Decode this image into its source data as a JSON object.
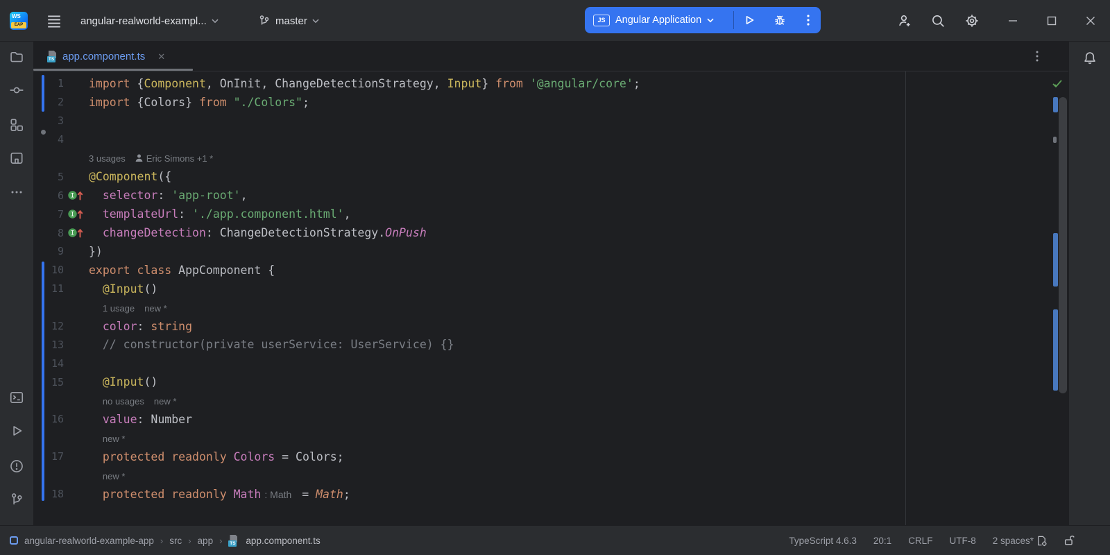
{
  "colors": {
    "accent_blue": "#3574F0",
    "panel_bg": "#2B2D30",
    "editor_bg": "#1E1F22",
    "keyword_orange": "#CF8E6D",
    "string_green": "#6AAB73",
    "decorator_yellow": "#C9B55C",
    "property_purple": "#C77DBB",
    "comment_gray": "#7A7E85",
    "modified_file_blue": "#6C9CF0",
    "logo_badge_yellow": "#F5C943",
    "gutter_change_blue": "#3574F0",
    "check_green": "#5C9F57"
  },
  "title_bar": {
    "app_badge": "WS",
    "app_badge_sub": "EAP",
    "project": "angular-realworld-exampl...",
    "branch": "master",
    "run_config": {
      "badge": "JS",
      "label": "Angular Application"
    }
  },
  "tab_bar": {
    "tabs": [
      {
        "label": "app.component.ts",
        "active": true
      }
    ]
  },
  "editor": {
    "change_bars": [
      {
        "from": 0,
        "to": 1
      },
      {
        "from": 10,
        "to": 22
      }
    ],
    "lines": [
      {
        "n": "1",
        "seg": [
          [
            "kw",
            "import "
          ],
          [
            "def",
            "{"
          ],
          [
            "deco",
            "Component"
          ],
          [
            "def",
            ", OnInit, ChangeDetectionStrategy, "
          ],
          [
            "deco",
            "Input"
          ],
          [
            "def",
            "} "
          ],
          [
            "kw",
            "from "
          ],
          [
            "str",
            "'@angular/core'"
          ],
          [
            "def",
            ";"
          ]
        ]
      },
      {
        "n": "2",
        "seg": [
          [
            "kw",
            "import "
          ],
          [
            "def",
            "{Colors} "
          ],
          [
            "kw",
            "from "
          ],
          [
            "str",
            "\"./Colors\""
          ],
          [
            "def",
            ";"
          ]
        ]
      },
      {
        "n": "3",
        "seg": []
      },
      {
        "n": "4",
        "seg": []
      },
      {
        "inlay": true,
        "seg": [
          [
            "usages",
            "3 usages"
          ],
          [
            "gap",
            ""
          ],
          [
            "person",
            ""
          ],
          [
            "author",
            "Eric Simons +1 *"
          ]
        ]
      },
      {
        "n": "5",
        "seg": [
          [
            "deco",
            "@Component"
          ],
          [
            "def",
            "({"
          ]
        ]
      },
      {
        "n": "6",
        "icon": true,
        "seg": [
          [
            "ind",
            "  "
          ],
          [
            "prop",
            "selector"
          ],
          [
            "def",
            ": "
          ],
          [
            "str",
            "'app-root'"
          ],
          [
            "def",
            ","
          ]
        ]
      },
      {
        "n": "7",
        "icon": true,
        "seg": [
          [
            "ind",
            "  "
          ],
          [
            "prop",
            "templateUrl"
          ],
          [
            "def",
            ": "
          ],
          [
            "str",
            "'./app.component.html'"
          ],
          [
            "def",
            ","
          ]
        ]
      },
      {
        "n": "8",
        "icon": true,
        "seg": [
          [
            "ind",
            "  "
          ],
          [
            "prop",
            "changeDetection"
          ],
          [
            "def",
            ": ChangeDetectionStrategy."
          ],
          [
            "enum",
            "OnPush"
          ]
        ]
      },
      {
        "n": "9",
        "seg": [
          [
            "def",
            "})"
          ]
        ]
      },
      {
        "n": "10",
        "seg": [
          [
            "kw",
            "export class "
          ],
          [
            "def",
            "AppComponent {"
          ]
        ]
      },
      {
        "n": "11",
        "seg": [
          [
            "ind",
            "  "
          ],
          [
            "deco",
            "@Input"
          ],
          [
            "def",
            "()"
          ]
        ]
      },
      {
        "inlay": true,
        "seg": [
          [
            "ind",
            "  "
          ],
          [
            "usages",
            "1 usage"
          ],
          [
            "gap",
            ""
          ],
          [
            "usages",
            "new *"
          ]
        ]
      },
      {
        "n": "12",
        "seg": [
          [
            "ind",
            "  "
          ],
          [
            "prop",
            "color"
          ],
          [
            "def",
            ": "
          ],
          [
            "kw",
            "string"
          ]
        ]
      },
      {
        "n": "13",
        "seg": [
          [
            "ind",
            "  "
          ],
          [
            "cmt",
            "// constructor(private userService: UserService) {}"
          ]
        ]
      },
      {
        "n": "14",
        "seg": []
      },
      {
        "n": "15",
        "seg": [
          [
            "ind",
            "  "
          ],
          [
            "deco",
            "@Input"
          ],
          [
            "def",
            "()"
          ]
        ]
      },
      {
        "inlay": true,
        "seg": [
          [
            "ind",
            "  "
          ],
          [
            "usages",
            "no usages"
          ],
          [
            "gap",
            ""
          ],
          [
            "usages",
            "new *"
          ]
        ]
      },
      {
        "n": "16",
        "seg": [
          [
            "ind",
            "  "
          ],
          [
            "prop",
            "value"
          ],
          [
            "def",
            ": Number"
          ]
        ]
      },
      {
        "inlay": true,
        "seg": [
          [
            "ind",
            "  "
          ],
          [
            "usages",
            "new *"
          ]
        ]
      },
      {
        "n": "17",
        "seg": [
          [
            "ind",
            "  "
          ],
          [
            "kw",
            "protected readonly "
          ],
          [
            "prop",
            "Colors"
          ],
          [
            "def",
            " = Colors;"
          ]
        ]
      },
      {
        "inlay": true,
        "seg": [
          [
            "ind",
            "  "
          ],
          [
            "usages",
            "new *"
          ]
        ]
      },
      {
        "n": "18",
        "seg": [
          [
            "ind",
            "  "
          ],
          [
            "kw",
            "protected readonly "
          ],
          [
            "prop",
            "Math"
          ],
          [
            "hint",
            ": Math"
          ],
          [
            "def",
            " = "
          ],
          [
            "glob",
            "Math"
          ],
          [
            "def",
            ";"
          ]
        ]
      }
    ]
  },
  "status_bar": {
    "breadcrumbs": [
      "angular-realworld-example-app",
      "src",
      "app",
      "app.component.ts"
    ],
    "items": [
      "TypeScript 4.6.3",
      "20:1",
      "CRLF",
      "UTF-8",
      "2 spaces*"
    ]
  }
}
